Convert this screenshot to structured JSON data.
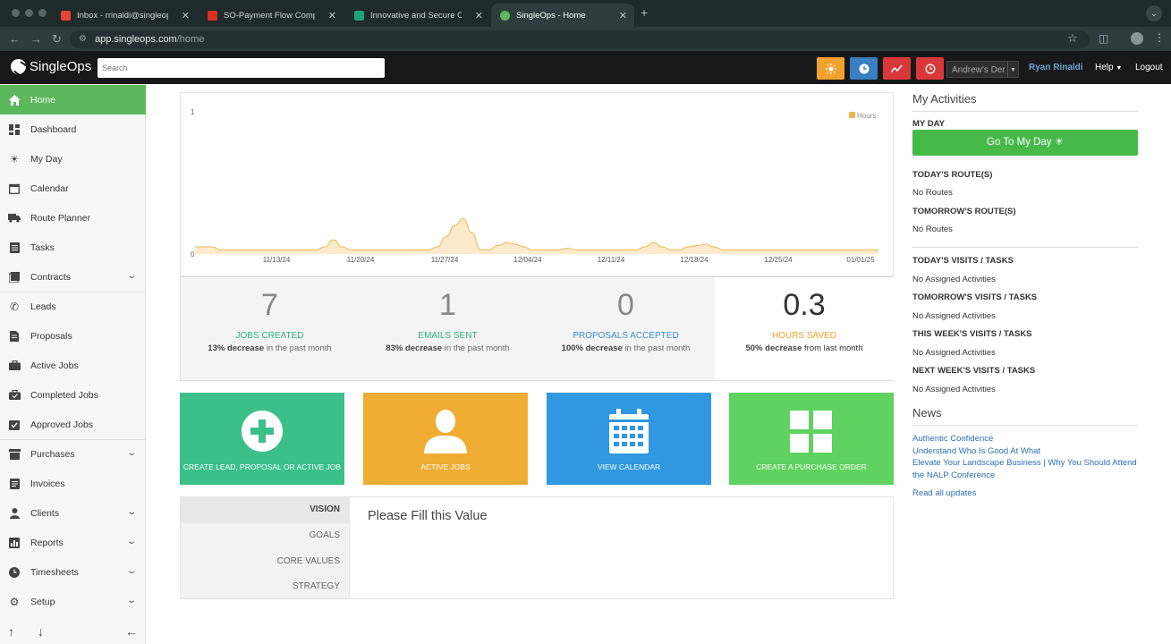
{
  "browser": {
    "tabs": [
      {
        "title": "Inbox - rrinaldi@singleops.co",
        "favicon_color": "#ea4335"
      },
      {
        "title": "SO-Payment Flow Comp-Gra",
        "favicon_color": "#d93025"
      },
      {
        "title": "Innovative and Secure Credit",
        "favicon_color": "#1aa37a"
      },
      {
        "title": "SingleOps - Home",
        "favicon_color": "#5cb85c"
      }
    ],
    "url_host": "app.singleops.com",
    "url_path": "/home"
  },
  "header": {
    "logo": "SingleOps",
    "search_placeholder": "Search",
    "buttons": [
      {
        "icon": "sun-icon",
        "color": "#f0a22e"
      },
      {
        "icon": "clock-icon",
        "color": "#3a7fc1"
      },
      {
        "icon": "trend-icon",
        "color": "#d9383a"
      },
      {
        "icon": "history-icon",
        "color": "#d9383a"
      }
    ],
    "company": "Andrew's Der",
    "user": "Ryan Rinaldi",
    "help": "Help",
    "logout": "Logout"
  },
  "sidebar": {
    "items": [
      {
        "label": "Home",
        "icon": "home-icon",
        "active": true
      },
      {
        "label": "Dashboard",
        "icon": "dashboard-icon"
      },
      {
        "label": "My Day",
        "icon": "sun-icon"
      },
      {
        "label": "Calendar",
        "icon": "calendar-icon"
      },
      {
        "label": "Route Planner",
        "icon": "truck-icon"
      },
      {
        "label": "Tasks",
        "icon": "tasks-icon"
      },
      {
        "label": "Contracts",
        "icon": "contracts-icon",
        "expandable": true
      },
      {
        "label": "Leads",
        "icon": "phone-icon"
      },
      {
        "label": "Proposals",
        "icon": "document-icon"
      },
      {
        "label": "Active Jobs",
        "icon": "briefcase-icon"
      },
      {
        "label": "Completed Jobs",
        "icon": "briefcase-check-icon"
      },
      {
        "label": "Approved Jobs",
        "icon": "approved-icon"
      },
      {
        "label": "Purchases",
        "icon": "purchases-icon",
        "expandable": true
      },
      {
        "label": "Invoices",
        "icon": "invoice-icon"
      },
      {
        "label": "Clients",
        "icon": "person-icon",
        "expandable": true
      },
      {
        "label": "Reports",
        "icon": "reports-icon",
        "expandable": true
      },
      {
        "label": "Timesheets",
        "icon": "clock-icon",
        "expandable": true
      },
      {
        "label": "Setup",
        "icon": "gear-icon",
        "expandable": true
      }
    ]
  },
  "chart_data": {
    "type": "area",
    "series": [
      {
        "name": "Hours",
        "color": "#f0b450",
        "values": [
          0.05,
          0.05,
          0.05,
          0.03,
          0.03,
          0.03,
          0.03,
          0.03,
          0.03,
          0.03,
          0.03,
          0.03,
          0.03,
          0.03,
          0.03,
          0.05,
          0.1,
          0.05,
          0.03,
          0.03,
          0.03,
          0.03,
          0.03,
          0.03,
          0.03,
          0.03,
          0.03,
          0.03,
          0.05,
          0.12,
          0.2,
          0.25,
          0.15,
          0.03,
          0.03,
          0.06,
          0.08,
          0.07,
          0.05,
          0.03,
          0.03,
          0.03,
          0.03,
          0.04,
          0.03,
          0.03,
          0.03,
          0.03,
          0.03,
          0.03,
          0.03,
          0.03,
          0.05,
          0.08,
          0.05,
          0.03,
          0.03,
          0.05,
          0.06,
          0.07,
          0.05,
          0.03,
          0.03,
          0.03,
          0.03,
          0.03,
          0.03,
          0.03,
          0.03,
          0.03,
          0.03,
          0.03,
          0.03,
          0.03,
          0.03,
          0.03,
          0.03,
          0.03,
          0.03,
          0.03
        ]
      }
    ],
    "x_labels": [
      "11/13/24",
      "11/20/24",
      "11/27/24",
      "12/04/24",
      "12/11/24",
      "12/18/24",
      "12/25/24",
      "01/01/25"
    ],
    "y_ticks": [
      "1",
      "0"
    ],
    "ylim": [
      0,
      1
    ],
    "legend": "top-right"
  },
  "stats": [
    {
      "value": "7",
      "label": "JOBS CREATED",
      "color": "#2ab27b",
      "pct": "13% decrease",
      "suffix": "in the past month"
    },
    {
      "value": "1",
      "label": "EMAILS SENT",
      "color": "#2ab27b",
      "pct": "83% decrease",
      "suffix": "in the past month"
    },
    {
      "value": "0",
      "label": "PROPOSALS ACCEPTED",
      "color": "#3a8fd0",
      "pct": "100% decrease",
      "suffix": "in the past month"
    },
    {
      "value": "0.3",
      "label": "HOURS SAVED",
      "color": "#f0a22e",
      "pct": "50% decrease",
      "suffix": "from last month"
    }
  ],
  "tiles": [
    {
      "label": "CREATE LEAD, PROPOSAL OR ACTIVE JOB",
      "color": "#3cc08a",
      "icon": "plus-circle-icon"
    },
    {
      "label": "ACTIVE JOBS",
      "color": "#efad34",
      "icon": "person-icon"
    },
    {
      "label": "VIEW CALENDAR",
      "color": "#2f98e0",
      "icon": "calendar-icon"
    },
    {
      "label": "CREATE A PURCHASE ORDER",
      "color": "#5fd25f",
      "icon": "grid-icon"
    }
  ],
  "vision": {
    "tabs": [
      "VISION",
      "GOALS",
      "CORE VALUES",
      "STRATEGY"
    ],
    "selected": "VISION",
    "content": "Please Fill this Value"
  },
  "activities": {
    "title": "My Activities",
    "my_day_heading": "MY DAY",
    "my_day_button": "Go To My Day",
    "sections": [
      {
        "heading": "TODAY'S ROUTE(S)",
        "value": "No Routes"
      },
      {
        "heading": "TOMORROW'S ROUTE(S)",
        "value": "No Routes"
      },
      {
        "heading": "TODAY'S VISITS / TASKS",
        "value": "No Assigned Activities"
      },
      {
        "heading": "TOMORROW'S VISITS / TASKS",
        "value": "No Assigned Activities"
      },
      {
        "heading": "THIS WEEK'S VISITS / TASKS",
        "value": "No Assigned Activities"
      },
      {
        "heading": "NEXT WEEK'S VISITS / TASKS",
        "value": "No Assigned Activities"
      }
    ]
  },
  "news": {
    "title": "News",
    "links": [
      "Authentic Confidence",
      "Understand Who Is Good At What",
      "Elevate Your Landscape Business | Why You Should Attend the NALP Conference"
    ],
    "read_all": "Read all updates"
  }
}
